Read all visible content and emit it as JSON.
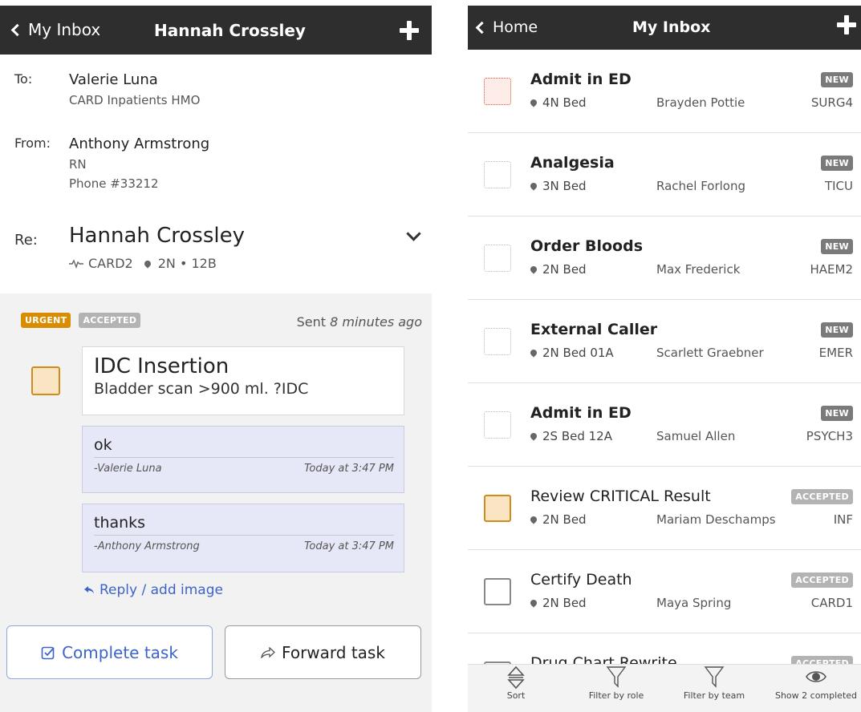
{
  "left": {
    "header": {
      "back_label": "My Inbox",
      "title": "Hannah Crossley"
    },
    "to": {
      "key": "To:",
      "name": "Valerie Luna",
      "sub": "CARD Inpatients HMO"
    },
    "from": {
      "key": "From:",
      "name": "Anthony Armstrong",
      "role": "RN",
      "phone": "Phone #33212"
    },
    "re": {
      "key": "Re:",
      "name": "Hannah Crossley",
      "team": "CARD2",
      "location": "2N • 12B"
    },
    "message": {
      "badge_urgent": "URGENT",
      "badge_accepted": "ACCEPTED",
      "sent_prefix": "Sent",
      "sent_time": "8 minutes ago",
      "task_title": "IDC Insertion",
      "task_body": "Bladder scan >900 ml. ?IDC",
      "replies": [
        {
          "text": "ok",
          "author": "-Valerie Luna",
          "time": "Today at 3:47 PM"
        },
        {
          "text": "thanks",
          "author": "-Anthony Armstrong",
          "time": "Today at 3:47 PM"
        }
      ],
      "reply_link": "Reply / add image"
    },
    "buttons": {
      "complete": "Complete task",
      "forward": "Forward task"
    }
  },
  "right": {
    "header": {
      "back_label": "Home",
      "title": "My Inbox"
    },
    "items": [
      {
        "title": "Admit in ED",
        "bold": true,
        "location": "4N Bed",
        "person": "Brayden Pottie",
        "unit": "SURG4",
        "badge": "NEW",
        "check": "red"
      },
      {
        "title": "Analgesia",
        "bold": true,
        "location": "3N Bed",
        "person": "Rachel Forlong",
        "unit": "TICU",
        "badge": "NEW",
        "check": "empty"
      },
      {
        "title": "Order Bloods",
        "bold": true,
        "location": "2N Bed",
        "person": "Max Frederick",
        "unit": "HAEM2",
        "badge": "NEW",
        "check": "empty"
      },
      {
        "title": "External Caller",
        "bold": true,
        "location": "2N Bed 01A",
        "person": "Scarlett Graebner",
        "unit": "EMER",
        "badge": "NEW",
        "check": "empty"
      },
      {
        "title": "Admit in ED",
        "bold": true,
        "location": "2S Bed 12A",
        "person": "Samuel Allen",
        "unit": "PSYCH3",
        "badge": "NEW",
        "check": "empty"
      },
      {
        "title": "Review CRITICAL Result",
        "bold": false,
        "location": "2N Bed",
        "person": "Mariam Deschamps",
        "unit": "INF",
        "badge": "ACCEPTED",
        "check": "amber"
      },
      {
        "title": "Certify Death",
        "bold": false,
        "location": "2N Bed",
        "person": "Maya Spring",
        "unit": "CARD1",
        "badge": "ACCEPTED",
        "check": "outline"
      },
      {
        "title": "Drug Chart Rewrite",
        "bold": false,
        "location": "",
        "person": "",
        "unit": "",
        "badge": "ACCEPTED",
        "check": "outline"
      }
    ],
    "toolbar": {
      "sort": "Sort",
      "filter_role": "Filter by role",
      "filter_team": "Filter by team",
      "show_completed": "Show 2 completed"
    }
  }
}
